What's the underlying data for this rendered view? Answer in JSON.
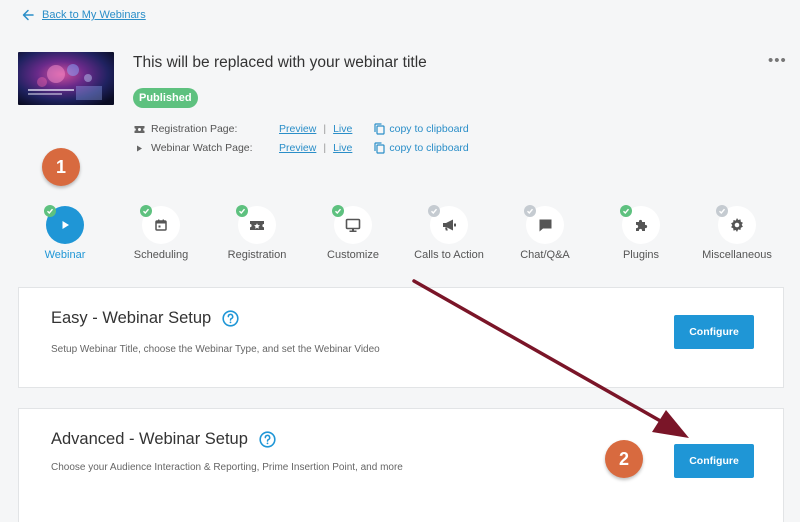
{
  "nav": {
    "back_label": "Back to My Webinars"
  },
  "webinar": {
    "title": "This will be replaced with your webinar title",
    "status": "Published",
    "links": [
      {
        "label": "Registration Page:",
        "preview": "Preview",
        "sep": "|",
        "live": "Live",
        "copy": "copy to clipboard",
        "icon": "ticket-icon"
      },
      {
        "label": "Webinar Watch Page:",
        "preview": "Preview",
        "sep": "|",
        "live": "Live",
        "copy": "copy to clipboard",
        "icon": "play-triangle-icon"
      }
    ]
  },
  "steps": [
    {
      "label": "Webinar",
      "icon": "play-icon",
      "completed": true,
      "active": true
    },
    {
      "label": "Scheduling",
      "icon": "calendar-icon",
      "completed": true,
      "active": false
    },
    {
      "label": "Registration",
      "icon": "ticket-icon",
      "completed": true,
      "active": false
    },
    {
      "label": "Customize",
      "icon": "monitor-icon",
      "completed": true,
      "active": false
    },
    {
      "label": "Calls to Action",
      "icon": "megaphone-icon",
      "completed": false,
      "active": false
    },
    {
      "label": "Chat/Q&A",
      "icon": "chat-icon",
      "completed": false,
      "active": false
    },
    {
      "label": "Plugins",
      "icon": "puzzle-icon",
      "completed": true,
      "active": false
    },
    {
      "label": "Miscellaneous",
      "icon": "gear-icon",
      "completed": false,
      "active": false
    }
  ],
  "cards": [
    {
      "title": "Easy - Webinar Setup",
      "description": "Setup Webinar Title, choose the Webinar Type, and set the Webinar Video",
      "button": "Configure"
    },
    {
      "title": "Advanced - Webinar Setup",
      "description": "Choose your Audience Interaction & Reporting, Prime Insertion Point, and more",
      "button": "Configure"
    }
  ],
  "annotations": {
    "marker_1": "1",
    "marker_2": "2"
  },
  "colors": {
    "accent": "#1f96d6",
    "success": "#5ec17f",
    "marker": "#d86a3f",
    "arrow": "#7a1528",
    "incomplete": "#c5cbd1"
  }
}
